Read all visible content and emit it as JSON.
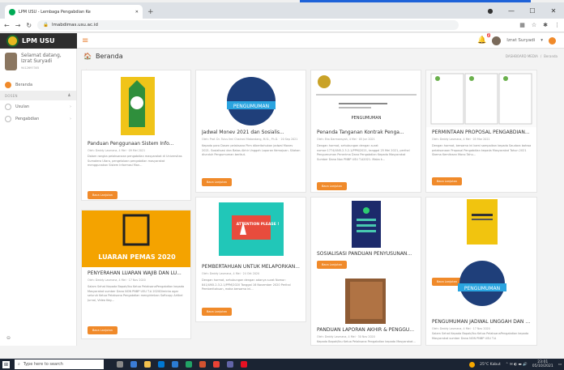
{
  "browser": {
    "tab_title": "LPM USU - Lembaga Pengabdian Ke",
    "new_tab": "+",
    "url": "lmabdimas.usu.ac.id"
  },
  "app": {
    "brand": "LPM USU",
    "notification_count": "2",
    "user_name": "Izrat Suryadi"
  },
  "sidebar": {
    "greeting": "Selamat datang,",
    "user_name": "Izrat Suryadi",
    "nip": "9412697305",
    "items": [
      {
        "label": "Beranda",
        "active": true
      },
      {
        "label": "Usulan"
      },
      {
        "label": "Pengabdian"
      }
    ],
    "group_label": "DOSEN"
  },
  "page": {
    "title": "Beranda",
    "breadcrumb": [
      "DASHBOARD MEDIA",
      "Beranda"
    ]
  },
  "cards": [
    {
      "title": "Panduan Penggunaan Sistem Info...",
      "meta": "Oleh: Deddy Lasmana, 4 Mei · 09 Mei 2021",
      "excerpt": "Dalam rangka pelaksanaan pengabdian masyarakat di Universitas Sumatera Utara, pengelolaan pengabdian masyarakat menggunakan Sistem Informasi Man...",
      "button": "Baca Lanjutan"
    },
    {
      "title": "Jadwal Monev 2021 dan Sosialis...",
      "meta": "Oleh: Prof. Dr. Tulus Ilmi Chairani Matondang, M.Si., Ph.D. · 20 Sep 2021",
      "excerpt": "Kepada para Dosen pelaksana Pkm diberitahukan jadwal Monev 2021. Sosialisasi dan Batas Akhir Unggah Laporan Kemajuan. Silakan diunduh Pengumuman berikut.",
      "button": "Baca Lanjutan",
      "image_text": "PENGUMUMAN"
    },
    {
      "title": "Penanda Tanganan Kontrak Penga...",
      "meta": "Oleh: Eka Darmansyah, 4 Mei · 05 Jun 2021",
      "excerpt": "Dengan hormat, sehubungan dengan surat nomor:1774/UN5.2.3.2.1/PPM/2021, tanggal 25 Mei 2021, perihal Pengumuman Penerima Dana Pengabdian Kepada Masyarakat Sumber Dana Non PNBP USU T.A2021. Maka k...",
      "button": "Baca Lanjutan",
      "doc_title": "PENGUMUMAN"
    },
    {
      "title": "PERMINTAAN PROPOSAL PENGABDIAN...",
      "meta": "Oleh: Deddy Lasmana, 4 Mei · 05 Mar 2021",
      "excerpt": "Dengan hormat, bersama ini kami sampaikan kepada Saudara bahwa pelaksanaan Proposal Pengabdian kepada Masyarakat Tahun 2021 Skema Kemitraan Mono Tahu...",
      "button": "Baca Lanjutan"
    },
    {
      "title": "PENYERAHAN LUARAN WAJIB DAN LU...",
      "meta": "Oleh: Deddy Lasmana, 4 Mei · 17 Nov 2020",
      "excerpt": "Salam Sehat Kepada Bapak/Ibu Ketua PelaksanaPengabdian kepada Masyarakat sumber Dana NON PNBP USU T.A 2020Diminta agar seluruh Ketua Pelaksana Pengabdian mengirimkan Softcopy Artikel Jurnal, Video Keg...",
      "button": "Baca Lanjutan",
      "image_text": "LUARAN PEMAS 2020"
    },
    {
      "title": "PEMBERTAHUAN UNTUK MELAPORKAN...",
      "meta": "Oleh: Deddy Lasmana, 4 Mei · 24 Okt 2020",
      "excerpt": "Dengan hormat, sehubungan dengan adanya surat Nomor: 841/UN5.2.3.2.1/PPM/2020 Tanggal 16 November 2020 Perihal Pemberitahuan, maka bersama ini...",
      "button": "Baca Lanjutan",
      "image_text": "ATTENTION PLEASE !"
    },
    {
      "title": "SOSIALISASI PANDUAN PENYUSUNAN...",
      "meta": "",
      "excerpt": "",
      "button": "Baca Lanjutan"
    },
    {
      "title": "PANDUAN LAPORAN AKHIR & PENGGU...",
      "meta": "Oleh: Deddy Lasmana, 4 Mei · 30 Nov 2020",
      "excerpt": "Kepada Bapak/Ibu Ketua Pelaksana Pengabdian kepada Masyarakat...",
      "button": ""
    },
    {
      "title": "PENGUMUMAN JADWAL UNGGAH DAN P...",
      "meta": "Oleh: Deddy Lasmana, 4 Mei · 17 Nov 2020",
      "excerpt": "Salam Sehat Kepada Bapak/Ibu Ketua PelaksanaPengabdian kepada Masyarakat sumber Dana NON PNBP USU T.A",
      "button": "Baca Lanjutan",
      "image_text": "PENGUMUMAN"
    }
  ],
  "taskbar": {
    "search_placeholder": "Type here to search",
    "weather": "25°C Kabut",
    "time": "23:01",
    "date": "05/10/2021"
  },
  "colors": {
    "accent": "#f08a2a",
    "brand_bg": "#2e2e2e",
    "highlight": "#1e62d8"
  }
}
